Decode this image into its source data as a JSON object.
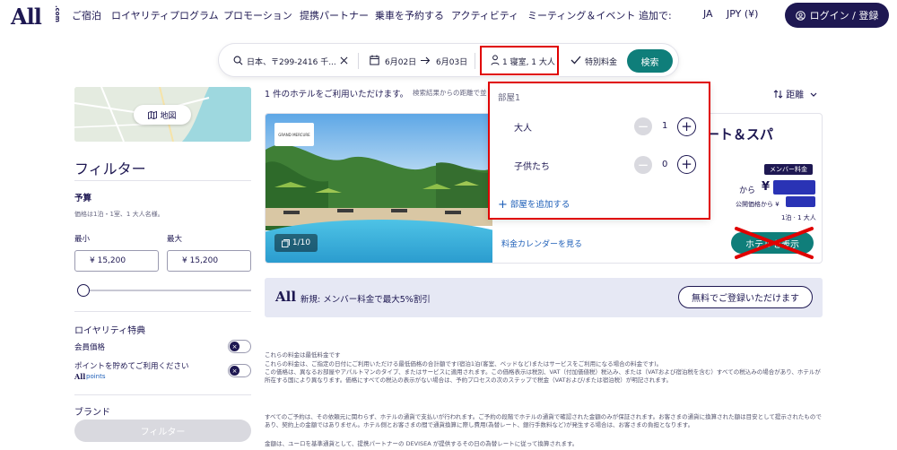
{
  "header": {
    "logo": "All",
    "logo_suffix": ".com",
    "nav": [
      "ご宿泊",
      "ロイヤリティプログラム",
      "プロモーション",
      "提携パートナー",
      "乗車を予約する",
      "アクティビティ",
      "ミーティング＆イベント",
      "追加で:"
    ],
    "language": "JA",
    "currency": "JPY (¥)",
    "login_label": "ログイン / 登録"
  },
  "search": {
    "destination": "日本、〒299-2416 千...",
    "checkin": "6月02日",
    "checkout": "6月03日",
    "occupancy": "1 寝室, 1 大人",
    "special_rate": "特別料金",
    "search_label": "検索"
  },
  "sidebar": {
    "map_label": "地図",
    "filters_title": "フィルター",
    "budget_label": "予算",
    "budget_note": "価格は1泊・1室、1 大人名様。",
    "min_label": "最小",
    "max_label": "最大",
    "min_value": "¥ 15,200",
    "max_value": "¥ 15,200",
    "loyalty_label": "ロイヤリティ特典",
    "member_rate_label": "会員価格",
    "points_label": "ポイントを貯めてご利用ください",
    "points_brand": "All",
    "points_sub": "points",
    "brand_label": "ブランド",
    "filter_button": "フィルター"
  },
  "results": {
    "count_text": "1 件のホテルをご利用いただけます。",
    "count_note": "検索結果からの距離で並",
    "sort_label": "距離"
  },
  "hotel": {
    "brand_logo": "GRAND MERCURE",
    "image_count": "1/10",
    "name": "ート＆スパ",
    "member_badge": "メンバー料金",
    "from_label": "から",
    "yen": "¥",
    "public_label": "公開価格から ¥",
    "per_night": "1泊 · 1 大人",
    "calendar_link": "料金カレンダーを見る",
    "view_button": "ホテルを表示"
  },
  "occupancy_popup": {
    "room_label": "部屋1",
    "adults_label": "大人",
    "adults_count": "1",
    "children_label": "子供たち",
    "children_count": "0",
    "add_room": "部屋を追加する"
  },
  "banner": {
    "logo": "All",
    "text": "新規: メンバー料金で最大5%割引",
    "button": "無料でご登録いただけます"
  },
  "fine_print": {
    "p1": "これらの料金は最低料金です",
    "p2": "これらの料金は、ご指定の日付にご利用いただける最低価格の合計額です(宿泊1泊(客室、ベッドなど)またはサービスをご利用になる場合の料金です)。",
    "p3": "この価格は、異なるお部屋やアパルトマンのタイプ、またはサービスに適用されます。この価格表示は税別、VAT（付加価値税）税込み、または（VATおよび宿泊税を含む）すべての税込みの場合があり、ホテルが所在する国により異なります。価格にすべての税込の表示がない場合は、予約プロセスの次のステップで税金（VATおよび/または宿泊税）が明記されます。",
    "p4": "すべてのご予約は、その依頼元に関わらず、ホテルの通貨で支払いが行われます。ご予約の段階でホテルの通貨で確認された金額のみが保証されます。お客さまの通貨に換算された額は目安として提示されたものであり、契約上の金額ではありません。ホテル側とお客さまの間で通貨換算に際し費用(為替レート、銀行手数料など)が発生する場合は、お客さまの負担となります。",
    "p5": "金額は、ユーロを基準通貨として、提携パートナーの DEVISEA が提供するその日の為替レートに従って換算されます。"
  },
  "colors": {
    "primary": "#1e1852",
    "accent": "#0f7e7a",
    "link": "#1e5fb8",
    "annotation_red": "#e00000"
  }
}
